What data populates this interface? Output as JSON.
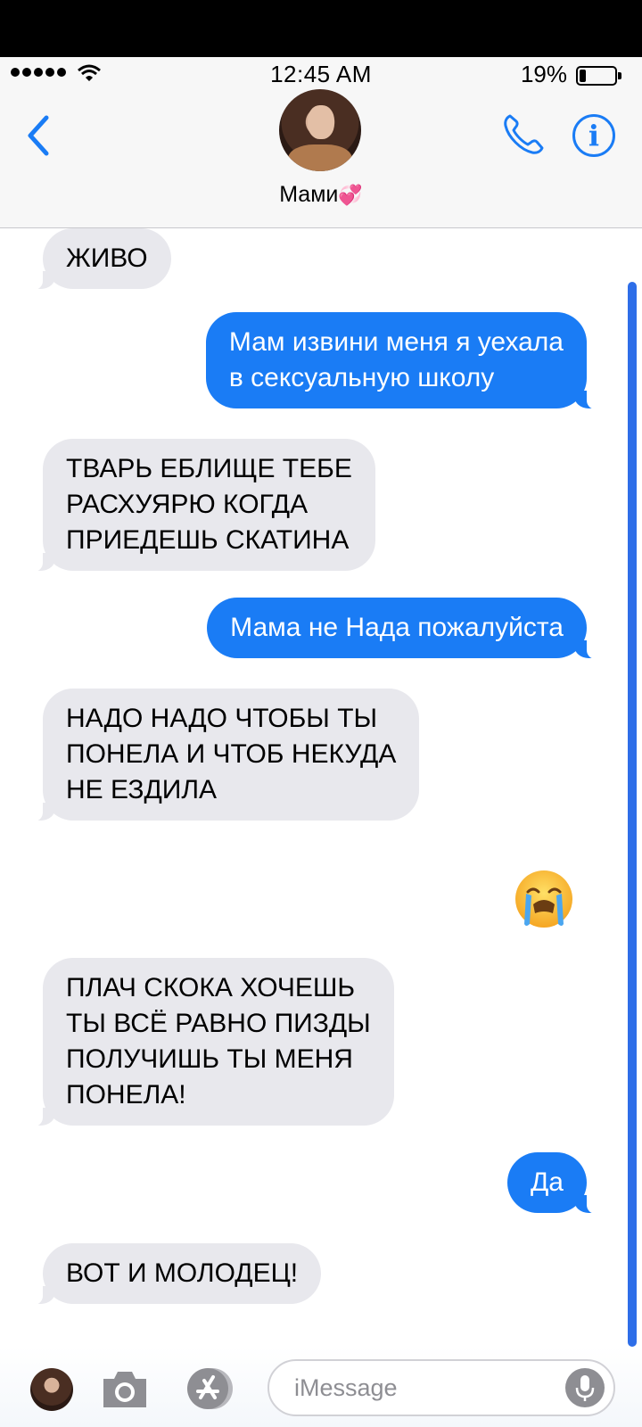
{
  "status_bar": {
    "time": "12:45 AM",
    "battery_percent_label": "19%",
    "battery_level": 0.19,
    "signal_bars": 5
  },
  "header": {
    "contact_name": "Мами",
    "contact_emoji": "💞",
    "back_icon": "chevron-left-icon",
    "call_icon": "phone-icon",
    "info_icon": "info-icon",
    "accent_color": "#1a7cf5"
  },
  "messages": [
    {
      "direction": "in",
      "text": "ЖИВО"
    },
    {
      "direction": "out",
      "text": "Мам извини меня я уехала\nв сексуальную школу"
    },
    {
      "direction": "in",
      "text": "ТВАРЬ ЕБЛИЩЕ ТЕБЕ\nРАСХУЯРЮ КОГДА\nПРИЕДЕШЬ СКАТИНА"
    },
    {
      "direction": "out",
      "text": "Мама не Нада пожалуйста"
    },
    {
      "direction": "in",
      "text": "НАДО НАДО ЧТОБЫ ТЫ\nПОНЕЛА И ЧТОБ НЕКУДА\nНЕ ЕЗДИЛА"
    },
    {
      "direction": "out",
      "text": "",
      "emoji": "loudly-crying-face"
    },
    {
      "direction": "in",
      "text": "ПЛАЧ СКОКА ХОЧЕШЬ\nТЫ ВСЁ РАВНО ПИЗДЫ\nПОЛУЧИШЬ ТЫ МЕНЯ\nПОНЕЛА!"
    },
    {
      "direction": "out",
      "text": "Да"
    },
    {
      "direction": "in",
      "text": "ВОТ И МОЛОДЕЦ!"
    }
  ],
  "input_bar": {
    "placeholder": "iMessage",
    "camera_icon": "camera-icon",
    "appstore_icon": "app-store-icon",
    "mic_icon": "microphone-icon"
  },
  "colors": {
    "outgoing_bubble": "#1a7cf5",
    "incoming_bubble": "#e8e8ed",
    "scrollbar": "#2e6ee8"
  }
}
